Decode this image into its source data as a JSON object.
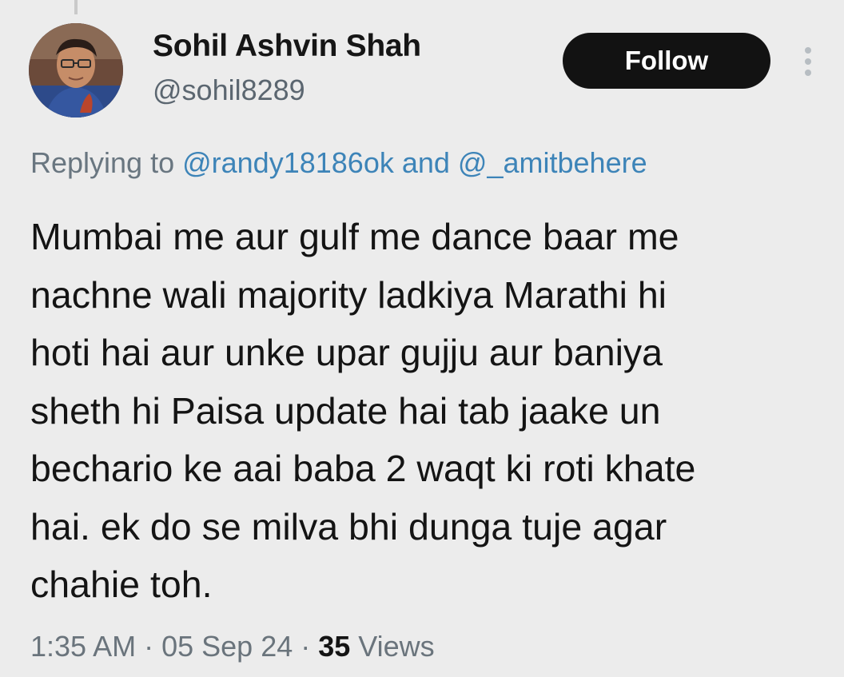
{
  "author": {
    "display_name": "Sohil Ashvin Shah",
    "handle": "@sohil8289"
  },
  "actions": {
    "follow_label": "Follow",
    "more_icon": "more-vertical-icon"
  },
  "reply": {
    "prefix": "Replying to ",
    "mention_1": "@randy18186ok",
    "joiner": " and ",
    "mention_2": "@_amitbehere"
  },
  "tweet": {
    "lines": [
      "Mumbai me aur gulf me dance baar me",
      "nachne wali majority ladkiya Marathi hi",
      "hoti hai aur unke upar gujju aur baniya",
      "sheth hi Paisa update hai tab jaake un",
      "bechario ke aai baba 2 waqt ki roti khate",
      "hai. ek do se milva bhi dunga tuje agar",
      "chahie toh."
    ]
  },
  "meta": {
    "time": "1:35 AM",
    "separator": " · ",
    "date": "05 Sep 24",
    "views_count": "35",
    "views_label": " Views"
  },
  "colors": {
    "background": "#ececec",
    "mention": "#3d84b8",
    "button_bg": "#121212"
  }
}
